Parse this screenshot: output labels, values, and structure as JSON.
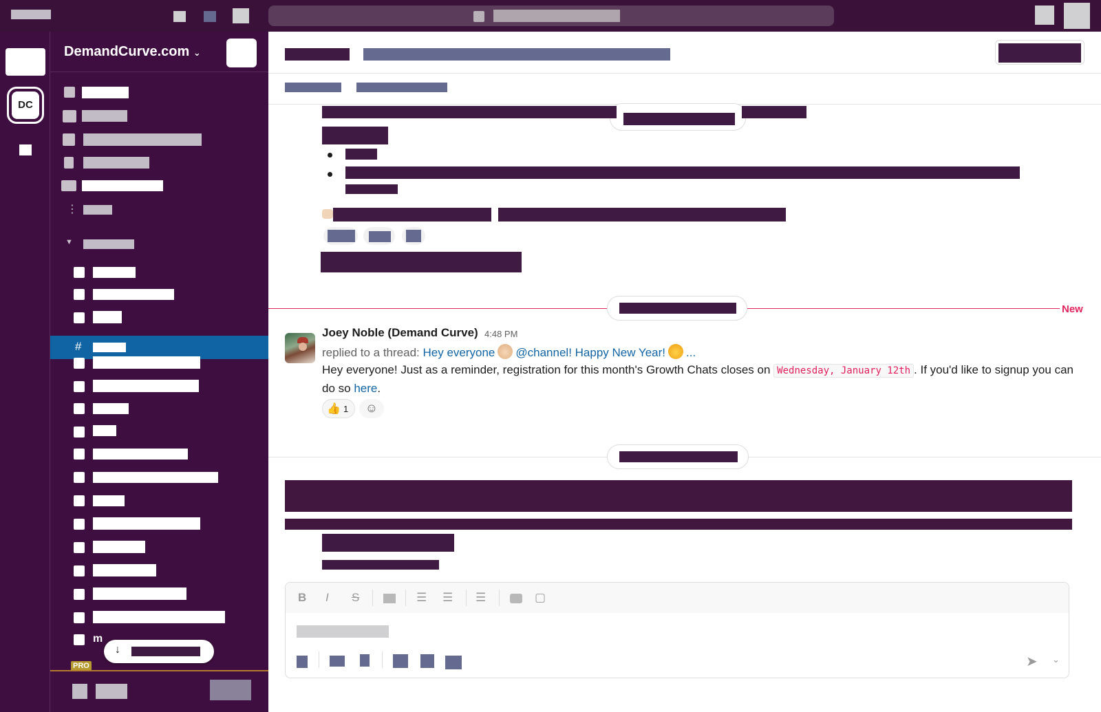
{
  "workspace": {
    "name": "DemandCurve.com",
    "dropdown_glyph": "⌄",
    "initials": "DC",
    "pro_badge": "PRO",
    "sidebar_partial_letter": "m"
  },
  "sidebar": {
    "active_prefix": "#",
    "jump_arrow": "↓"
  },
  "messages": {
    "new_label": "New",
    "reply": {
      "author": "Joey Noble (Demand Curve)",
      "time": "4:48 PM",
      "thread_prefix": "replied to a thread:",
      "thread_link_1": "Hey everyone",
      "thread_link_2": "@channel! Happy New Year!",
      "thread_ellipsis": "...",
      "body_before": "Hey everyone! Just as a reminder, registration for this month's Growth Chats closes on ",
      "body_code": "Wednesday, January 12th",
      "body_after": ". If you'd like to signup you can do so ",
      "body_link": "here",
      "body_end": ".",
      "reaction_emoji": "👍",
      "reaction_count": "1",
      "add_reaction_glyph": "☺"
    }
  },
  "composer": {
    "bold": "B",
    "italic": "I",
    "strike": "S",
    "send_glyph": "➤",
    "send_menu_glyph": "⌄"
  }
}
